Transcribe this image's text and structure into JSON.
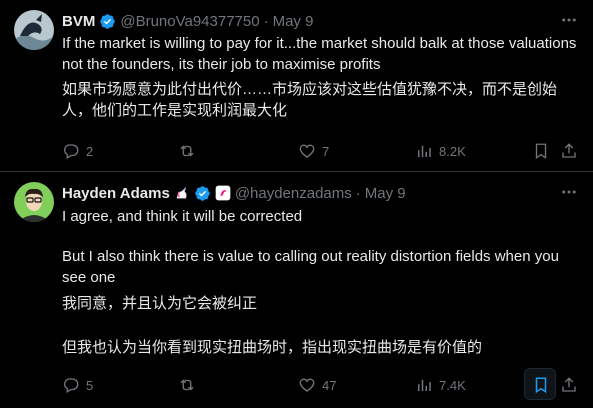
{
  "tweets": [
    {
      "name": "BVM",
      "handle": "@BrunoVa94377750",
      "sep": "·",
      "date": "May 9",
      "text_en": "If the market is willing to pay for it...the market should balk at those valuations not the founders, its their job to maximise profits",
      "text_zh": "如果市场愿意为此付出代价……市场应该对这些估值犹豫不决，而不是创始人，他们的工作是实现利润最大化",
      "replies": "2",
      "retweets": "",
      "likes": "7",
      "views": "8.2K"
    },
    {
      "name": "Hayden Adams",
      "handle": "@haydenzadams",
      "sep": "·",
      "date": "May 9",
      "text_en_1": "I agree, and think it will be corrected",
      "text_en_2": "But I also think there is value to calling out reality distortion fields when you see one",
      "text_zh_1": "我同意，并且认为它会被纠正",
      "text_zh_2": "但我也认为当你看到现实扭曲场时，指出现实扭曲场是有价值的",
      "replies": "5",
      "retweets": "",
      "likes": "47",
      "views": "7.4K"
    }
  ],
  "colors": {
    "verified": "#1d9bf0",
    "muted": "#71767b",
    "bookmark_active": "#1d9bf0"
  }
}
